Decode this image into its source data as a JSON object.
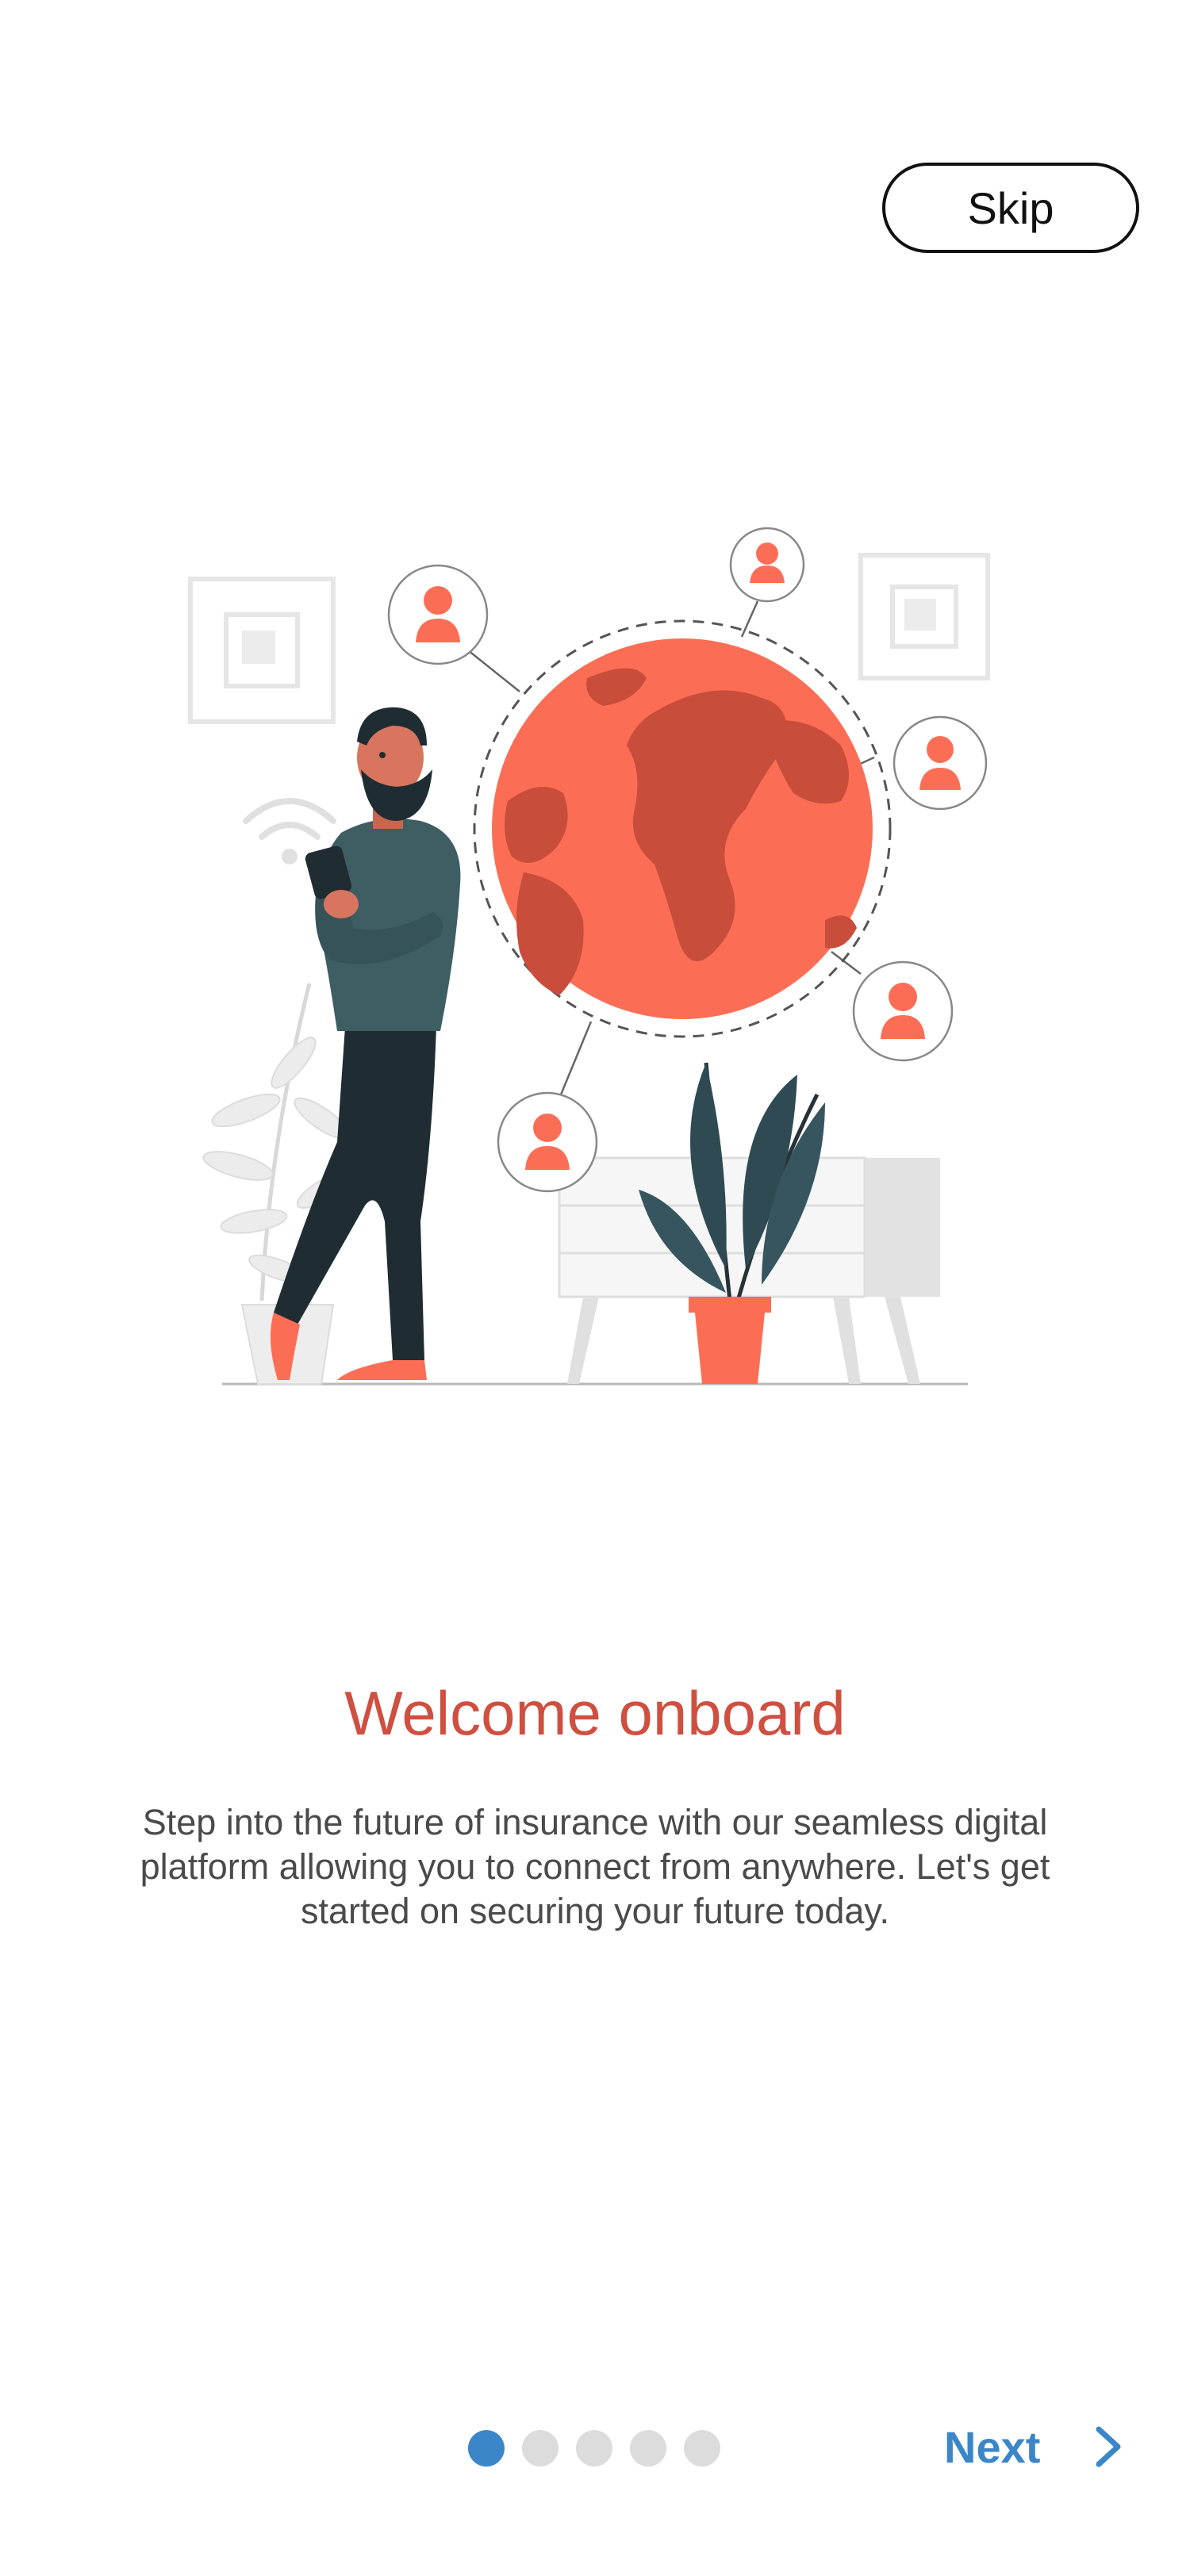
{
  "header": {
    "skip_label": "Skip"
  },
  "onboarding": {
    "title": "Welcome onboard",
    "description": "Step into the future of insurance with our seamless digital platform allowing you to connect from anywhere. Let's get started on securing your future today.",
    "illustration_icon": "man-with-phone-globe-network-illustration"
  },
  "pager": {
    "total_pages": 5,
    "current_page": 1
  },
  "footer": {
    "next_label": "Next",
    "next_icon": "chevron-right-icon"
  },
  "colors": {
    "accent": "#3a86c8",
    "title": "#cf4f40",
    "illustration_primary": "#fb6e55",
    "illustration_dark": "#263238",
    "text": "#4a4a4a"
  }
}
